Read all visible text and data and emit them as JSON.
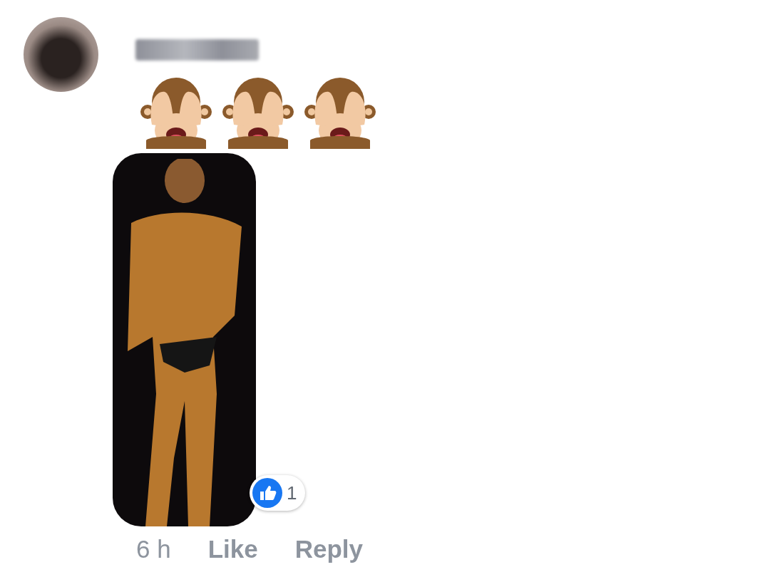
{
  "comment": {
    "icons": [
      {
        "kind": "monkey"
      },
      {
        "kind": "monkey"
      },
      {
        "kind": "monkey"
      }
    ],
    "reaction": {
      "count": "1"
    },
    "actions": [
      {
        "kind": "time",
        "label": "6 h"
      },
      {
        "kind": "link",
        "label": "Like"
      },
      {
        "kind": "link",
        "label": "Reply"
      }
    ]
  }
}
